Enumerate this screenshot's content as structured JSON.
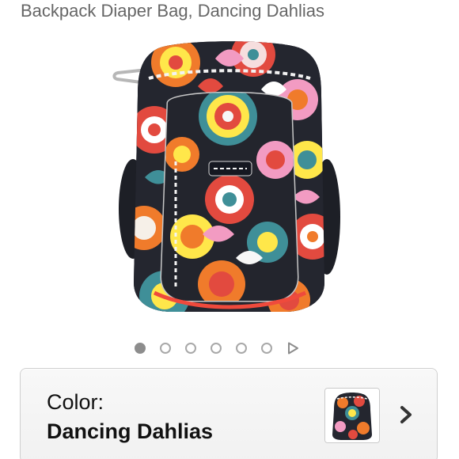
{
  "product": {
    "title": "Backpack Diaper Bag, Dancing Dahlias",
    "image_icon": "backpack-product-image"
  },
  "carousel": {
    "active_index": 1,
    "dot_count": 6,
    "next_icon": "play-triangle-icon"
  },
  "color_selector": {
    "label": "Color:",
    "value": "Dancing Dahlias",
    "swatch_icon": "backpack-swatch-thumbnail",
    "chevron_icon": "chevron-right-icon"
  },
  "colors": {
    "page_background": "#ffffff",
    "title_text": "#666666",
    "card_border": "#cfcfcf",
    "card_background": "#f4f4f4",
    "active_dot": "#8d8d8d",
    "inactive_dot_border": "#a8a8a8",
    "pattern_black": "#22252e",
    "pattern_red": "#e24a3f",
    "pattern_orange": "#f28a25",
    "pattern_yellow": "#ffe74a",
    "pattern_teal": "#3f8f98",
    "pattern_pink": "#f29bc2"
  }
}
